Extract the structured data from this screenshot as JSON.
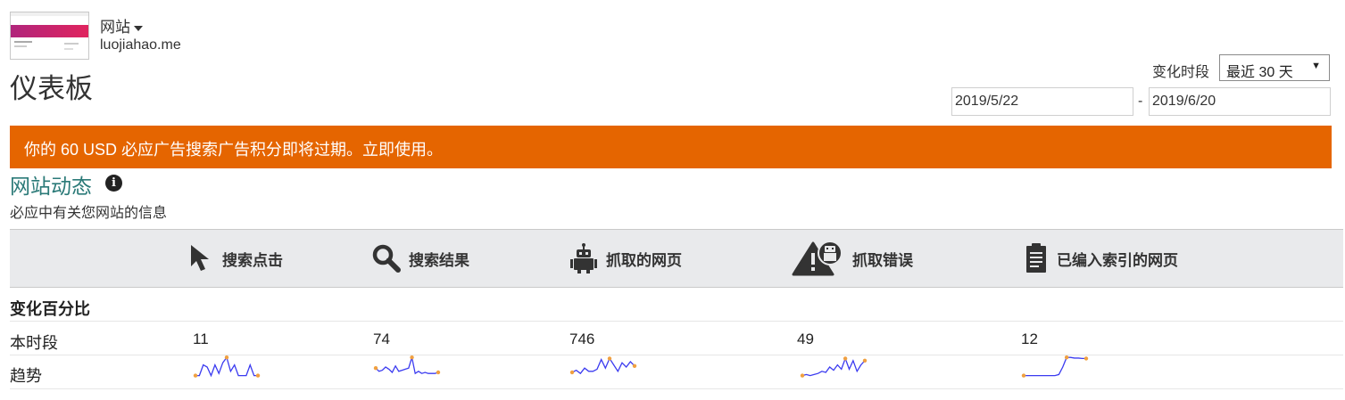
{
  "site": {
    "selector_label": "网站",
    "url": "luojiahao.me"
  },
  "page_title": "仪表板",
  "period": {
    "label": "变化时段",
    "selected": "最近 30 天",
    "date_from": "2019/5/22",
    "date_sep": "-",
    "date_to": "2019/6/20"
  },
  "banner": {
    "text": "你的 60 USD 必应广告搜索广告积分即将过期。立即使用。",
    "color": "#e56500"
  },
  "activity": {
    "title": "网站动态",
    "info_glyph": "i",
    "subtitle": "必应中有关您网站的信息"
  },
  "metrics": [
    {
      "label": "搜索点击",
      "icon": "cursor-icon",
      "current": "11",
      "trend": [
        0.1,
        0.1,
        0.6,
        0.5,
        0.1,
        0.6,
        0.2,
        0.7,
        0.95,
        0.3,
        0.6,
        0.1,
        0.1,
        0.1,
        0.6,
        0.1,
        0.1
      ]
    },
    {
      "label": "搜索结果",
      "icon": "magnifier-icon",
      "current": "74",
      "trend": [
        0.45,
        0.3,
        0.35,
        0.5,
        0.4,
        0.25,
        0.55,
        0.3,
        0.35,
        0.4,
        0.45,
        0.95,
        0.2,
        0.3,
        0.2,
        0.25,
        0.2,
        0.2,
        0.2,
        0.25
      ]
    },
    {
      "label": "抓取的网页",
      "icon": "robot-icon",
      "current": "746",
      "trend": [
        0.25,
        0.35,
        0.2,
        0.45,
        0.3,
        0.3,
        0.4,
        0.85,
        0.45,
        0.9,
        0.6,
        0.3,
        0.7,
        0.5,
        0.75,
        0.55
      ]
    },
    {
      "label": "抓取错误",
      "icon": "robot-warning-icon",
      "current": "49",
      "trend": [
        0.1,
        0.15,
        0.1,
        0.15,
        0.2,
        0.3,
        0.25,
        0.5,
        0.35,
        0.6,
        0.4,
        0.9,
        0.4,
        0.8,
        0.3,
        0.6,
        0.8
      ]
    },
    {
      "label": "已编入索引的网页",
      "icon": "document-icon",
      "current": "12",
      "trend": [
        0.1,
        0.1,
        0.1,
        0.1,
        0.1,
        0.1,
        0.1,
        0.1,
        0.1,
        0.15,
        0.5,
        0.95,
        0.95,
        0.92,
        0.92,
        0.9,
        0.9
      ]
    }
  ],
  "table": {
    "header": "变化百分比",
    "row_current_label": "本时段",
    "row_trend_label": "趋势"
  },
  "colors": {
    "trend_line": "#3b3bf0",
    "trend_point": "#f0a040",
    "section_title": "#2b7a78"
  }
}
